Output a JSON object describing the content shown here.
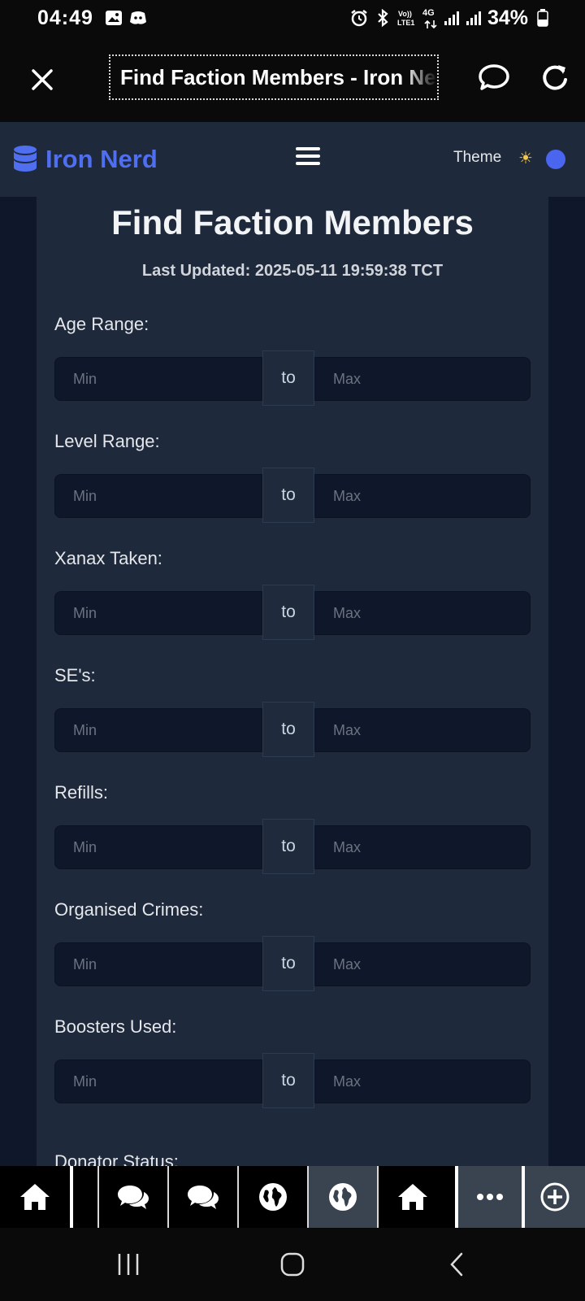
{
  "status_bar": {
    "time": "04:49",
    "network": "4G",
    "battery": "34%",
    "icons": [
      "image-icon",
      "discord-icon",
      "alarm-icon",
      "bluetooth-icon",
      "volte-icon",
      "signal-icon",
      "battery-icon"
    ]
  },
  "browser": {
    "tab_title": "Find Faction Members - Iron Nerd",
    "icons": [
      "close-icon",
      "chat-bubble-icon",
      "reload-icon"
    ]
  },
  "site_nav": {
    "brand": "Iron Nerd",
    "theme_label": "Theme",
    "icons": [
      "database-icon",
      "hamburger-menu-icon",
      "sun-icon"
    ],
    "toggle_color": "#4a65ee"
  },
  "page": {
    "title": "Find Faction Members",
    "last_updated": "Last Updated: 2025-05-11 19:59:38 TCT",
    "separator": "to",
    "min_placeholder": "Min",
    "max_placeholder": "Max",
    "filters": [
      {
        "label": "Age Range:"
      },
      {
        "label": "Level Range:"
      },
      {
        "label": "Xanax Taken:"
      },
      {
        "label": "SE's:"
      },
      {
        "label": "Refills:"
      },
      {
        "label": "Organised Crimes:"
      },
      {
        "label": "Boosters Used:"
      },
      {
        "label": "Donator Status:"
      }
    ]
  },
  "tab_strip": {
    "icons": [
      "home-icon",
      "chat-bubbles-icon",
      "chat-bubbles-icon",
      "globe-icon",
      "globe-icon",
      "home-icon",
      "more-icon",
      "add-tab-icon"
    ]
  },
  "android_nav": {
    "icons": [
      "recent-apps-icon",
      "home-circle-icon",
      "back-icon"
    ]
  },
  "colors": {
    "accent": "#4f6ef0",
    "nav_bg": "#1e293b",
    "card_bg": "#1e293b",
    "input_bg": "#0f172a"
  }
}
